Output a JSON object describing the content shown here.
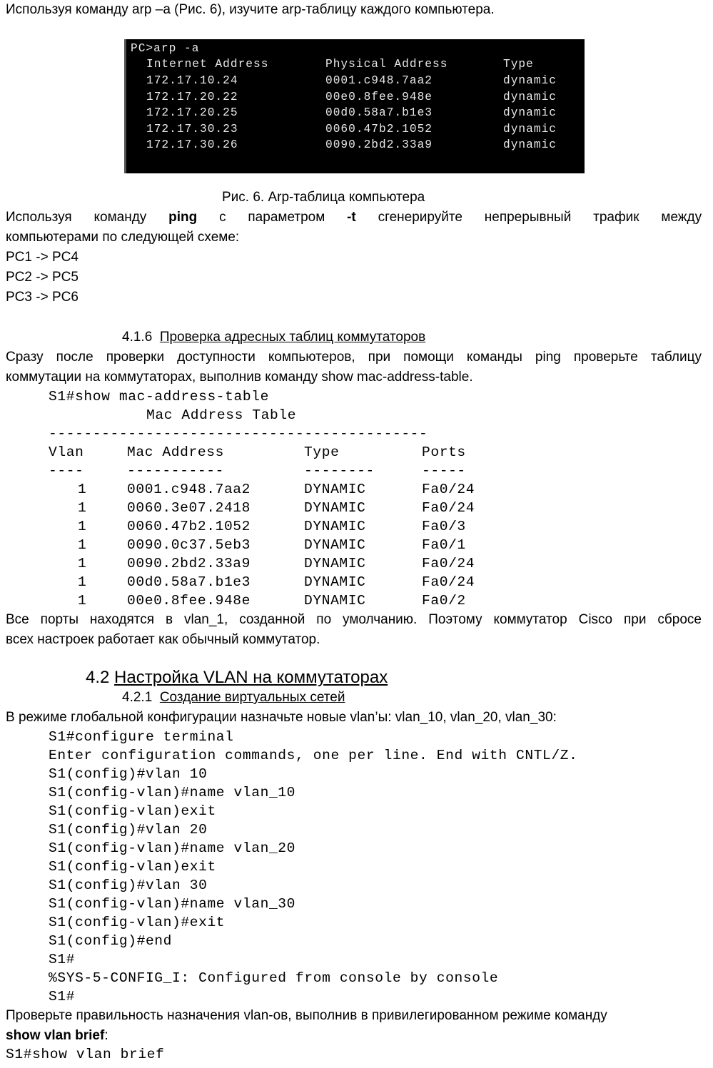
{
  "intro": "Используя команду arp –a (Рис. 6), изучите arp-таблицу каждого компьютера.",
  "terminal": {
    "prompt": "PC>arp -a",
    "headers": [
      "Internet Address",
      "Physical Address",
      "Type"
    ],
    "rows": [
      [
        "172.17.10.24",
        "0001.c948.7aa2",
        "dynamic"
      ],
      [
        "172.17.20.22",
        "00e0.8fee.948e",
        "dynamic"
      ],
      [
        "172.17.20.25",
        "00d0.58a7.b1e3",
        "dynamic"
      ],
      [
        "172.17.30.23",
        "0060.47b2.1052",
        "dynamic"
      ],
      [
        "172.17.30.26",
        "0090.2bd2.33a9",
        "dynamic"
      ]
    ]
  },
  "caption": "Рис. 6. Arp-таблица компьютера",
  "ping_para": {
    "w1": "Используя",
    "w2": "команду",
    "w3": "ping",
    "w4": "с",
    "w5": "параметром",
    "w6": "-t",
    "w7": "сгенерируйте",
    "w8": "непрерывный",
    "w9": "трафик",
    "w10": "между",
    "line2": "компьютерами по следующей схеме:"
  },
  "pairs": [
    "PC1 -> PC4",
    "PC2 -> PC5",
    "PC3 -> PC6"
  ],
  "sec416": {
    "num": "4.1.6",
    "title": "Проверка адресных таблиц коммутаторов"
  },
  "para416": {
    "line1": "Сразу после проверки доступности компьютеров, при помощи команды ping проверьте таблицу",
    "line2": "коммутации на коммутаторах, выполнив команду  show mac-address-table."
  },
  "mac": {
    "cmd": "S1#show mac-address-table",
    "title": "Mac Address Table",
    "sep": "-------------------------------------------",
    "headers": [
      "Vlan",
      "Mac Address",
      "Type",
      "Ports"
    ],
    "dashes": [
      "----",
      "-----------",
      "--------",
      "-----"
    ],
    "rows": [
      [
        "1",
        "0001.c948.7aa2",
        "DYNAMIC",
        "Fa0/24"
      ],
      [
        "1",
        "0060.3e07.2418",
        "DYNAMIC",
        "Fa0/24"
      ],
      [
        "1",
        "0060.47b2.1052",
        "DYNAMIC",
        "Fa0/3"
      ],
      [
        "1",
        "0090.0c37.5eb3",
        "DYNAMIC",
        "Fa0/1"
      ],
      [
        "1",
        "0090.2bd2.33a9",
        "DYNAMIC",
        "Fa0/24"
      ],
      [
        "1",
        "00d0.58a7.b1e3",
        "DYNAMIC",
        "Fa0/24"
      ],
      [
        "1",
        "00e0.8fee.948e",
        "DYNAMIC",
        "Fa0/2"
      ]
    ]
  },
  "vlan_para": {
    "line1": "Все порты находятся в  vlan_1, созданной по умолчанию. Поэтому коммутатор Cisco при сбросе",
    "line2": "всех настроек работает как обычный коммутатор."
  },
  "sec42": {
    "num": "4.2",
    "title": "Настройка VLAN на коммутаторах"
  },
  "sec421": {
    "num": "4.2.1",
    "title": "Создание виртуальных сетей"
  },
  "global_para": "В режиме глобальной конфигурации назначьте новые vlan’ы:  vlan_10, vlan_20, vlan_30:",
  "config": [
    "S1#configure terminal",
    "Enter configuration commands, one per line.  End with CNTL/Z.",
    "S1(config)#vlan 10",
    "S1(config-vlan)#name vlan_10",
    "S1(config-vlan)exit",
    "S1(config)#vlan 20",
    "S1(config-vlan)#name vlan_20",
    "S1(config-vlan)exit",
    "S1(config)#vlan 30",
    "S1(config-vlan)#name vlan_30",
    "S1(config-vlan)#exit",
    "S1(config)#end",
    " S1#",
    " %SYS-5-CONFIG_I: Configured from console by console",
    " S1#"
  ],
  "check_para": {
    "line1": "Проверьте правильность назначения vlan-ов, выполнив в привилегированном режиме команду",
    "bold": "show vlan brief",
    "colon": ":"
  },
  "final_cmd": "S1#show vlan brief"
}
